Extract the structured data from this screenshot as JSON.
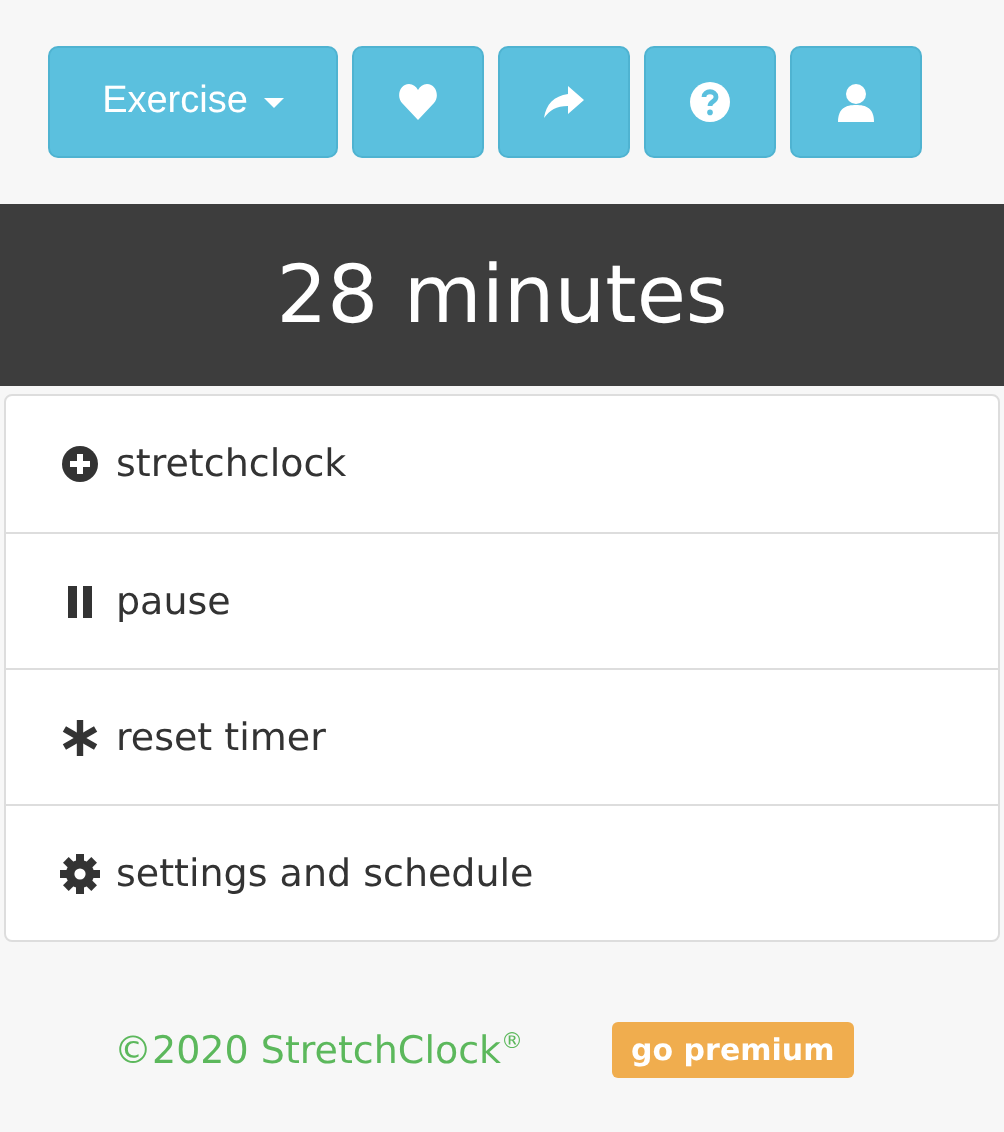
{
  "toolbar": {
    "dropdown": {
      "label": "Exercise"
    },
    "icon_buttons": [
      {
        "kind": "heart"
      },
      {
        "kind": "share"
      },
      {
        "kind": "help"
      },
      {
        "kind": "user"
      }
    ]
  },
  "timer": {
    "text": "28 minutes"
  },
  "menu": [
    {
      "kind": "plus",
      "label": "stretchclock"
    },
    {
      "kind": "pause",
      "label": "pause"
    },
    {
      "kind": "asterisk",
      "label": "reset timer"
    },
    {
      "kind": "gear",
      "label": "settings and schedule"
    }
  ],
  "footer": {
    "copyright": "©2020 StretchClock$^{®}$",
    "premium": "go premium"
  }
}
